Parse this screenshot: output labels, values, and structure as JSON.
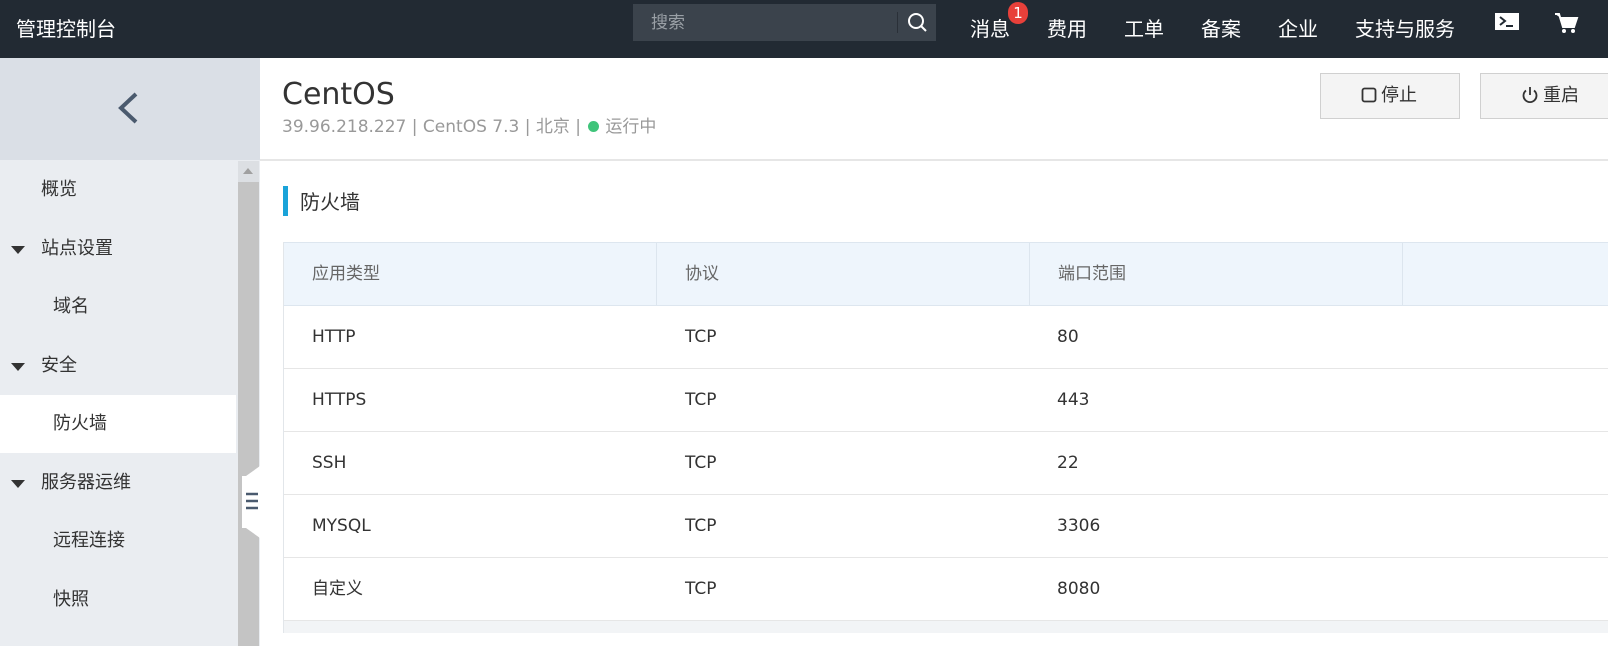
{
  "topbar": {
    "brand": "管理控制台",
    "search_placeholder": "搜索",
    "messages_label": "消息",
    "messages_badge": "1",
    "nav": [
      "费用",
      "工单",
      "备案",
      "企业",
      "支持与服务"
    ]
  },
  "sidebar": {
    "items": [
      {
        "label": "概览"
      },
      {
        "label": "站点设置"
      },
      {
        "label": "域名"
      },
      {
        "label": "安全"
      },
      {
        "label": "防火墙"
      },
      {
        "label": "服务器运维"
      },
      {
        "label": "远程连接"
      },
      {
        "label": "快照"
      }
    ],
    "active": "防火墙"
  },
  "instance": {
    "name": "CentOS",
    "ip": "39.96.218.227",
    "os": "CentOS 7.3",
    "region": "北京",
    "separator": "|",
    "status": "运行中",
    "status_color": "#3fc47a"
  },
  "actions": {
    "stop_label": "停止",
    "restart_label": "重启"
  },
  "firewall": {
    "title": "防火墙",
    "columns": [
      "应用类型",
      "协议",
      "端口范围",
      ""
    ],
    "rows": [
      [
        "HTTP",
        "TCP",
        "80"
      ],
      [
        "HTTPS",
        "TCP",
        "443"
      ],
      [
        "SSH",
        "TCP",
        "22"
      ],
      [
        "MYSQL",
        "TCP",
        "3306"
      ],
      [
        "自定义",
        "TCP",
        "8080"
      ]
    ]
  },
  "colors": {
    "topbar_bg": "#222a33",
    "accent": "#1aa3d9",
    "badge": "#e8403a",
    "table_header_bg": "#eef5fc"
  }
}
